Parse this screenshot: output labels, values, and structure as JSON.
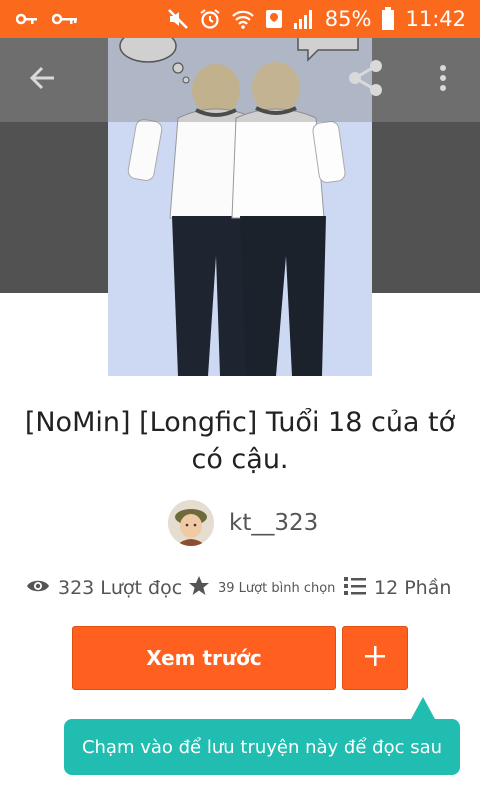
{
  "status_bar": {
    "battery_percent": "85%",
    "time": "11:42",
    "icons_left": [
      "key-icon",
      "key-icon"
    ],
    "icons_right": [
      "mute-icon",
      "alarm-icon",
      "wifi-icon",
      "notification-icon",
      "signal-icon",
      "battery-icon"
    ]
  },
  "toolbar": {
    "back_icon": "arrow-left-icon",
    "share_icon": "share-icon",
    "more_icon": "more-vertical-icon"
  },
  "story": {
    "title": "[NoMin] [Longfic] Tuổi 18 của tớ có cậu.",
    "author": "kt__323"
  },
  "stats": {
    "reads": "323 Lượt đọc",
    "votes": "39 Lượt bình chọn",
    "parts": "12 Phần"
  },
  "actions": {
    "preview_label": "Xem trước",
    "add_label": "+"
  },
  "tooltip": {
    "text": "Chạm vào để lưu truyện này để đọc sau"
  },
  "colors": {
    "status_bar": "#fb6a1c",
    "primary_button": "#ff5f1f",
    "tooltip": "#21bdb0",
    "header_bg": "#525252"
  }
}
